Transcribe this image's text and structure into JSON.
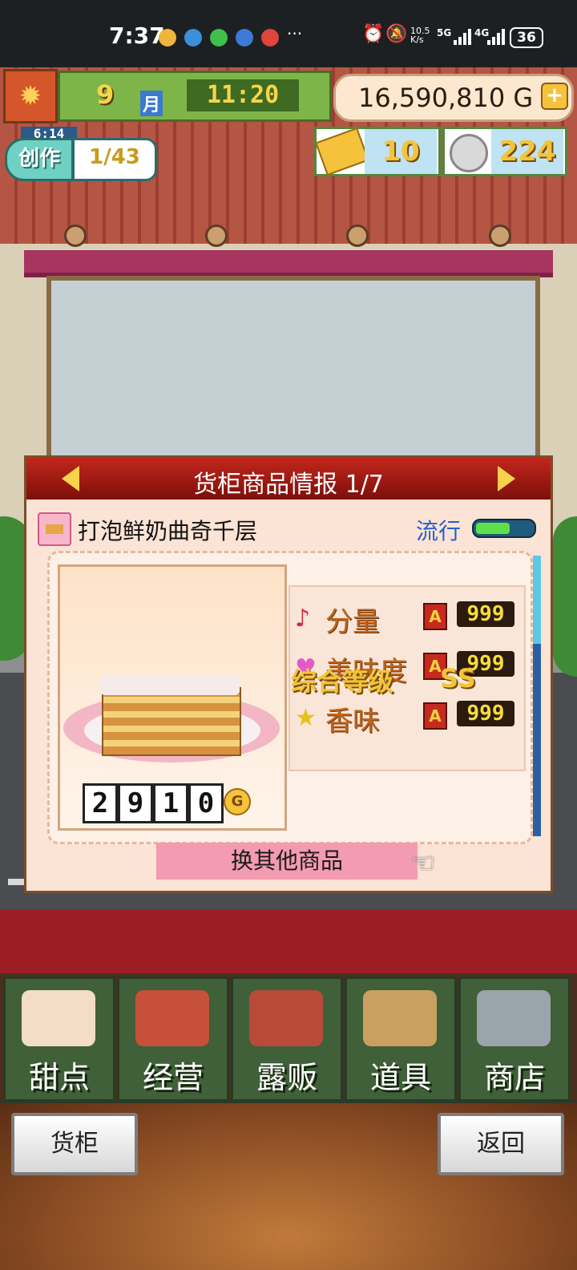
{
  "status_bar": {
    "time": "7:37",
    "more": "···",
    "net_speed_top": "10.5",
    "net_speed_bottom": "K/s",
    "net1": "5G",
    "net2": "4G",
    "battery": "36"
  },
  "hud": {
    "month": "9",
    "month_label": "月",
    "clock": "11:20",
    "money": "16,590,810 G",
    "create_timer": "6:14",
    "create_label": "创作",
    "create_count": "1/43",
    "tickets": "10",
    "medals": "224"
  },
  "panel": {
    "title": "货柜商品情报 1/7",
    "item_name": "打泡鲜奶曲奇千层",
    "trend_label": "流行",
    "trend_level": 0.6,
    "price_digits": [
      "2",
      "9",
      "1",
      "0"
    ],
    "price_unit": "G",
    "stats": [
      {
        "label": "分量",
        "icon": "music-note-icon",
        "grade": "A",
        "value": "999"
      },
      {
        "label": "美味度",
        "icon": "heart-icon",
        "grade": "A",
        "value": "999"
      },
      {
        "label": "香味",
        "icon": "star-icon",
        "grade": "A",
        "value": "999"
      }
    ],
    "overall_label": "综合等级",
    "overall_value": "SS",
    "swap_button": "换其他商品"
  },
  "nav": {
    "items": [
      {
        "label": "甜点",
        "icon": "cake-icon"
      },
      {
        "label": "经营",
        "icon": "shop-icon"
      },
      {
        "label": "露贩",
        "icon": "food-truck-icon"
      },
      {
        "label": "道具",
        "icon": "gear-bag-icon"
      },
      {
        "label": "商店",
        "icon": "cart-icon"
      }
    ]
  },
  "bottom": {
    "left_button": "货柜",
    "right_button": "返回"
  },
  "colors": {
    "panel_header": "#c2271c",
    "trend_label": "#2460d0",
    "nav_green": "#3f6038",
    "swap_button": "#f39bb1"
  }
}
